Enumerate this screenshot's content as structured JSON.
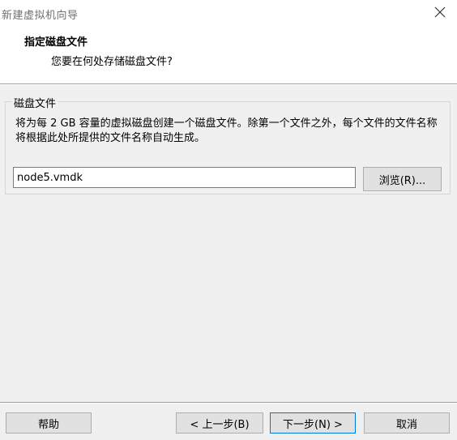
{
  "window": {
    "title": "新建虚拟机向导"
  },
  "header": {
    "title": "指定磁盘文件",
    "subtitle": "您要在何处存储磁盘文件?"
  },
  "disk_file_group": {
    "legend": "磁盘文件",
    "description": "将为每 2 GB 容量的虚拟磁盘创建一个磁盘文件。除第一个文件之外，每个文件的文件名称将根据此处所提供的文件名称自动生成。",
    "filename_value": "node5.vmdk",
    "browse_label": "浏览(R)..."
  },
  "footer": {
    "help_label": "帮助",
    "back_label": "< 上一步(B)",
    "next_label": "下一步(N) >",
    "cancel_label": "取消"
  },
  "icons": {
    "close": "close-icon"
  }
}
